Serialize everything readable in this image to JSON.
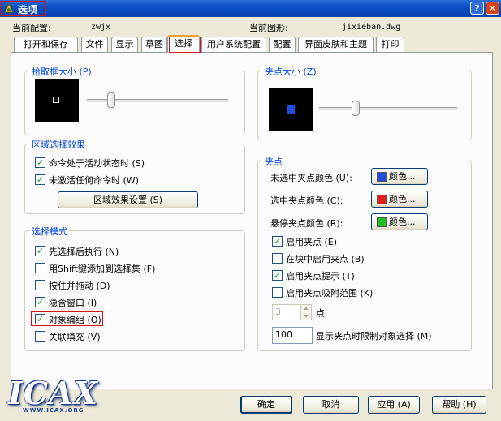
{
  "window": {
    "title": "选项",
    "help_glyph": "?",
    "close_glyph": "✕"
  },
  "header": {
    "current_config_label": "当前配置:",
    "current_config_value": "zwjx",
    "current_drawing_label": "当前图形:",
    "current_drawing_value": "jixieban.dwg"
  },
  "tabs": [
    {
      "label": "打开和保存"
    },
    {
      "label": "文件"
    },
    {
      "label": "显示"
    },
    {
      "label": "草图"
    },
    {
      "label": "选择",
      "active": true
    },
    {
      "label": "用户系统配置"
    },
    {
      "label": "配置"
    },
    {
      "label": "界面皮肤和主题"
    },
    {
      "label": "打印"
    }
  ],
  "pickbox": {
    "title": "拾取框大小 (P)",
    "slider_level": 0.15
  },
  "selection_preview": {
    "title": "区域选择效果",
    "items": [
      {
        "label": "命令处于活动状态时 (S)",
        "checked": true
      },
      {
        "label": "未激活任何命令时 (W)",
        "checked": true
      }
    ],
    "button": "区域效果设置 (S)"
  },
  "selection_modes": {
    "title": "选择模式",
    "items": [
      {
        "label": "先选择后执行 (N)",
        "checked": true
      },
      {
        "label": "用Shift键添加到选择集 (F)",
        "checked": false
      },
      {
        "label": "按住并拖动 (D)",
        "checked": false
      },
      {
        "label": "隐含窗口 (I)",
        "checked": true
      },
      {
        "label": "对象编组 (O)",
        "checked": true
      },
      {
        "label": "关联填充 (V)",
        "checked": false
      }
    ]
  },
  "grip_size": {
    "title": "夹点大小 (Z)",
    "slider_level": 0.25
  },
  "grips": {
    "title": "夹点",
    "colors": [
      {
        "label": "未选中夹点颜色 (U):",
        "button": "颜色...",
        "color": "#1f4fd8"
      },
      {
        "label": "选中夹点颜色 (C):",
        "button": "颜色...",
        "color": "#e01e1e"
      },
      {
        "label": "悬停夹点颜色 (R):",
        "button": "颜色...",
        "color": "#21c021"
      }
    ],
    "options": [
      {
        "label": "启用夹点 (E)",
        "checked": true
      },
      {
        "label": "在块中启用夹点 (B)",
        "checked": false
      },
      {
        "label": "启用夹点提示 (T)",
        "checked": true
      },
      {
        "label": "启用夹点吸附范围 (K)",
        "checked": false
      }
    ],
    "spinner_value": "3",
    "spinner_label": "点",
    "limit_value": "100",
    "limit_label": "显示夹点时限制对象选择 (M)"
  },
  "footer": {
    "ok": "确定",
    "cancel": "取消",
    "apply": "应用 (A)",
    "help": "帮助 (H)"
  },
  "watermark": {
    "logo": "ICAX",
    "url": "WWW.ICAX.ORG"
  }
}
